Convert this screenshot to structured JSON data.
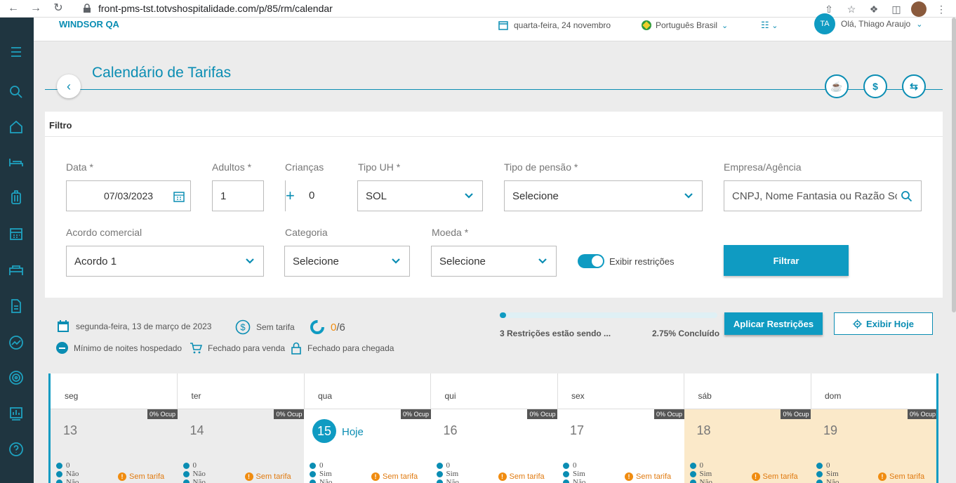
{
  "browser": {
    "url": "front-pms-tst.totvshospitalidade.com/p/85/rm/calendar"
  },
  "topbar": {
    "hotel_name": "WINDSOR QA",
    "date": "quarta-feira, 24 novembro",
    "language": "Português Brasil",
    "user_initials": "TA",
    "user_greeting": "Olá, Thiago Araujo"
  },
  "page": {
    "title": "Calendário de Tarifas"
  },
  "filter": {
    "heading": "Filtro",
    "date_label": "Data *",
    "date_value": "07/03/2023",
    "adults_label": "Adultos *",
    "adults_value": "1",
    "children_label": "Crianças",
    "children_value": "0",
    "room_type_label": "Tipo UH *",
    "room_type_value": "SOL",
    "board_label": "Tipo de pensão *",
    "board_value": "Selecione",
    "company_label": "Empresa/Agência",
    "company_placeholder": "CNPJ, Nome Fantasia ou Razão Sc",
    "agreement_label": "Acordo comercial",
    "agreement_value": "Acordo 1",
    "category_label": "Categoria",
    "category_value": "Selecione",
    "currency_label": "Moeda *",
    "currency_value": "Selecione",
    "restrictions_toggle_label": "Exibir restrições",
    "restrictions_toggle_on": true,
    "filter_button": "Filtrar"
  },
  "legend": {
    "selected_date": "segunda-feira, 13 de março de 2023",
    "no_rate": "Sem tarifa",
    "ratio_count": "0",
    "ratio_total": "/6",
    "min_nights": "Mínimo de noites hospedado",
    "closed_sale": "Fechado para venda",
    "closed_arrival": "Fechado para chegada"
  },
  "progress": {
    "fraction": 0.0275,
    "status_text": "3 Restrições estão sendo ...",
    "percent_text": "2.75% Concluído"
  },
  "actions": {
    "apply_restrictions": "Aplicar Restrições",
    "show_today": "Exibir Hoje"
  },
  "calendar": {
    "today_label": "Hoje",
    "days": [
      {
        "name": "seg",
        "num": "13",
        "ocup": "0% Ocup",
        "count": "0",
        "closed_sale": "Não",
        "closed_arrival": "Não",
        "rate": "Sem tarifa",
        "weekend": false,
        "today": false
      },
      {
        "name": "ter",
        "num": "14",
        "ocup": "0% Ocup",
        "count": "0",
        "closed_sale": "Não",
        "closed_arrival": "Não",
        "rate": "Sem tarifa",
        "weekend": false,
        "today": false
      },
      {
        "name": "qua",
        "num": "15",
        "ocup": "0% Ocup",
        "count": "0",
        "closed_sale": "Sim",
        "closed_arrival": "Não",
        "rate": "Sem tarifa",
        "weekend": false,
        "today": true
      },
      {
        "name": "qui",
        "num": "16",
        "ocup": "0% Ocup",
        "count": "0",
        "closed_sale": "Sim",
        "closed_arrival": "Não",
        "rate": "Sem tarifa",
        "weekend": false,
        "today": false
      },
      {
        "name": "sex",
        "num": "17",
        "ocup": "0% Ocup",
        "count": "0",
        "closed_sale": "Sim",
        "closed_arrival": "Não",
        "rate": "Sem tarifa",
        "weekend": false,
        "today": false
      },
      {
        "name": "sáb",
        "num": "18",
        "ocup": "0% Ocup",
        "count": "0",
        "closed_sale": "Sim",
        "closed_arrival": "Não",
        "rate": "Sem tarifa",
        "weekend": true,
        "today": false
      },
      {
        "name": "dom",
        "num": "19",
        "ocup": "0% Ocup",
        "count": "0",
        "closed_sale": "Sim",
        "closed_arrival": "Não",
        "rate": "Sem tarifa",
        "weekend": true,
        "today": false
      }
    ]
  },
  "colors": {
    "accent": "#0f9bc2",
    "sidebar": "#1f3540",
    "weekend": "#fbe9c9",
    "past": "#ececec",
    "warning": "#f08c10"
  }
}
